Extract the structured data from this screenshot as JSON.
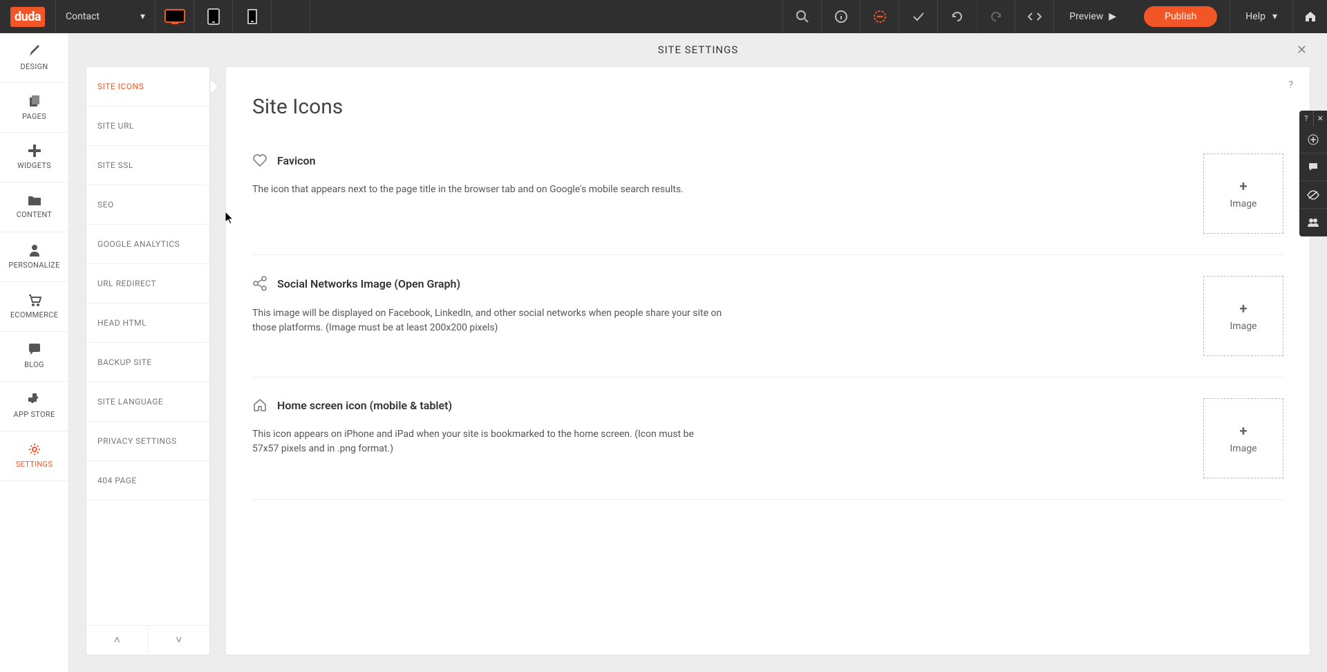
{
  "logo_text": "duda",
  "page_dropdown": "Contact",
  "topbar": {
    "preview": "Preview",
    "publish": "Publish",
    "help": "Help"
  },
  "sidebar": {
    "items": [
      {
        "label": "DESIGN"
      },
      {
        "label": "PAGES"
      },
      {
        "label": "WIDGETS"
      },
      {
        "label": "CONTENT"
      },
      {
        "label": "PERSONALIZE"
      },
      {
        "label": "ECOMMERCE"
      },
      {
        "label": "BLOG"
      },
      {
        "label": "APP STORE"
      },
      {
        "label": "SETTINGS"
      }
    ]
  },
  "panel_title": "SITE SETTINGS",
  "sec_menu": [
    "SITE ICONS",
    "SITE URL",
    "SITE SSL",
    "SEO",
    "GOOGLE ANALYTICS",
    "URL REDIRECT",
    "HEAD HTML",
    "BACKUP SITE",
    "SITE LANGUAGE",
    "PRIVACY SETTINGS",
    "404 PAGE"
  ],
  "content": {
    "heading": "Site Icons",
    "help": "?",
    "sections": [
      {
        "title": "Favicon",
        "desc": "The icon that appears next to the page title in the browser tab and on Google's mobile search results.",
        "upload": "Image"
      },
      {
        "title": "Social Networks Image (Open Graph)",
        "desc": "This image will be displayed on Facebook, LinkedIn, and other social networks when people share your site on those platforms. (Image must be at least 200x200 pixels)",
        "upload": "Image"
      },
      {
        "title": "Home screen icon (mobile & tablet)",
        "desc": "This icon appears on iPhone and iPad when your site is bookmarked to the home screen. (Icon must be 57x57 pixels and in .png format.)",
        "upload": "Image"
      }
    ]
  },
  "right_float": {
    "help": "?",
    "close": "✕"
  }
}
